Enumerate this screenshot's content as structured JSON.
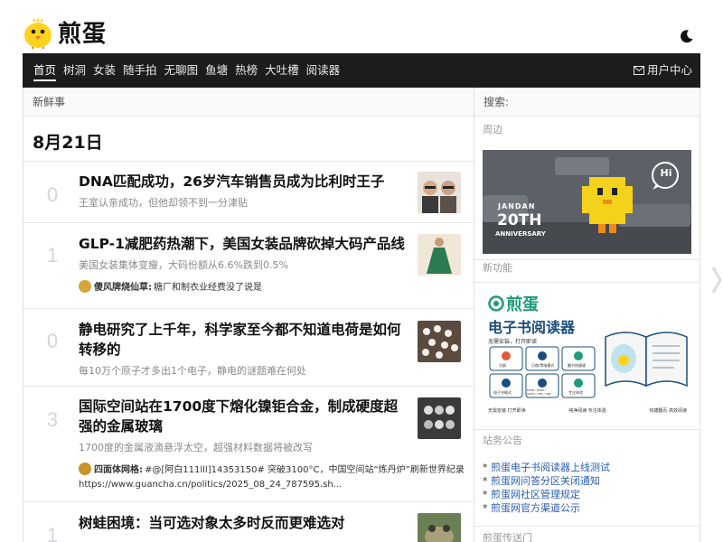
{
  "brand": {
    "name": "煎蛋"
  },
  "nav": {
    "items": [
      "首页",
      "树洞",
      "女装",
      "随手拍",
      "无聊图",
      "鱼塘",
      "热榜",
      "大吐槽",
      "阅读器"
    ],
    "active_index": 0,
    "user_center": "用户中心"
  },
  "main": {
    "section_title": "新鲜事",
    "date": "8月21日",
    "posts": [
      {
        "count": "0",
        "title": "DNA匹配成功，26岁汽车销售员成为比利时王子",
        "excerpt": "王室认亲成功，但他却领不到一分津贴"
      },
      {
        "count": "1",
        "title": "GLP-1减肥药热潮下，美国女装品牌砍掉大码产品线",
        "excerpt": "美国女装集体变瘦，大码份额从6.6%跌到0.5%",
        "comment": {
          "author": "傻风牌烧仙草:",
          "text": "糖厂和制衣业经费没了说是"
        }
      },
      {
        "count": "0",
        "title": "静电研究了上千年，科学家至今都不知道电荷是如何转移的",
        "excerpt": "每10万个原子才多出1个电子，静电的谜题难在何处"
      },
      {
        "count": "3",
        "title": "国际空间站在1700度下熔化镍钜合金，制成硬度超强的金属玻璃",
        "excerpt": "1700度的金属液滴悬浮太空，超强材料数据将被改写",
        "comment": {
          "author": "四面体网格:",
          "text": "#@[阿白111lll]14353150# 突破3100°C，中国空间站“炼丹炉”刷新世界纪录"
        },
        "url": "https://www.guancha.cn/politics/2025_08_24_787595.sh..."
      },
      {
        "count": "1",
        "title": "树蛙困境：当可选对象太多时反而更难选对",
        "excerpt": ""
      }
    ]
  },
  "sidebar": {
    "search_label": "搜索:",
    "nearby_label": "周边",
    "anniversary": {
      "line1": "JANDAN",
      "line2": "20TH",
      "line3": "ANNIVERSARY",
      "badge": "Hi"
    },
    "new_feature_label": "新功能",
    "ebook": {
      "brand": "煎蛋",
      "title": "电子书阅读器",
      "features": [
        "无需安装，打开即读",
        "大纲",
        "日夜/黑暗模式",
        "翻书快捷键",
        "电子书格式",
        "EPUB / MOBI / AZW3 / FB2 / CBZ",
        "专注体验"
      ],
      "footer": [
        "无需安装 打开即读",
        "纯净阅读 专注体验",
        "快捷翻页 高效阅读"
      ]
    },
    "announcements_label": "站务公告",
    "announcements": [
      "煎蛋电子书阅读器上线测试",
      "煎蛋网问答分区关闭通知",
      "煎蛋网社区管理规定",
      "煎蛋网官方渠道公示"
    ],
    "more_label": "煎蛋传送门"
  },
  "colors": {
    "nav_bg": "#1c1c1c",
    "link": "#2a5db0",
    "count": "#cfd6e0"
  }
}
